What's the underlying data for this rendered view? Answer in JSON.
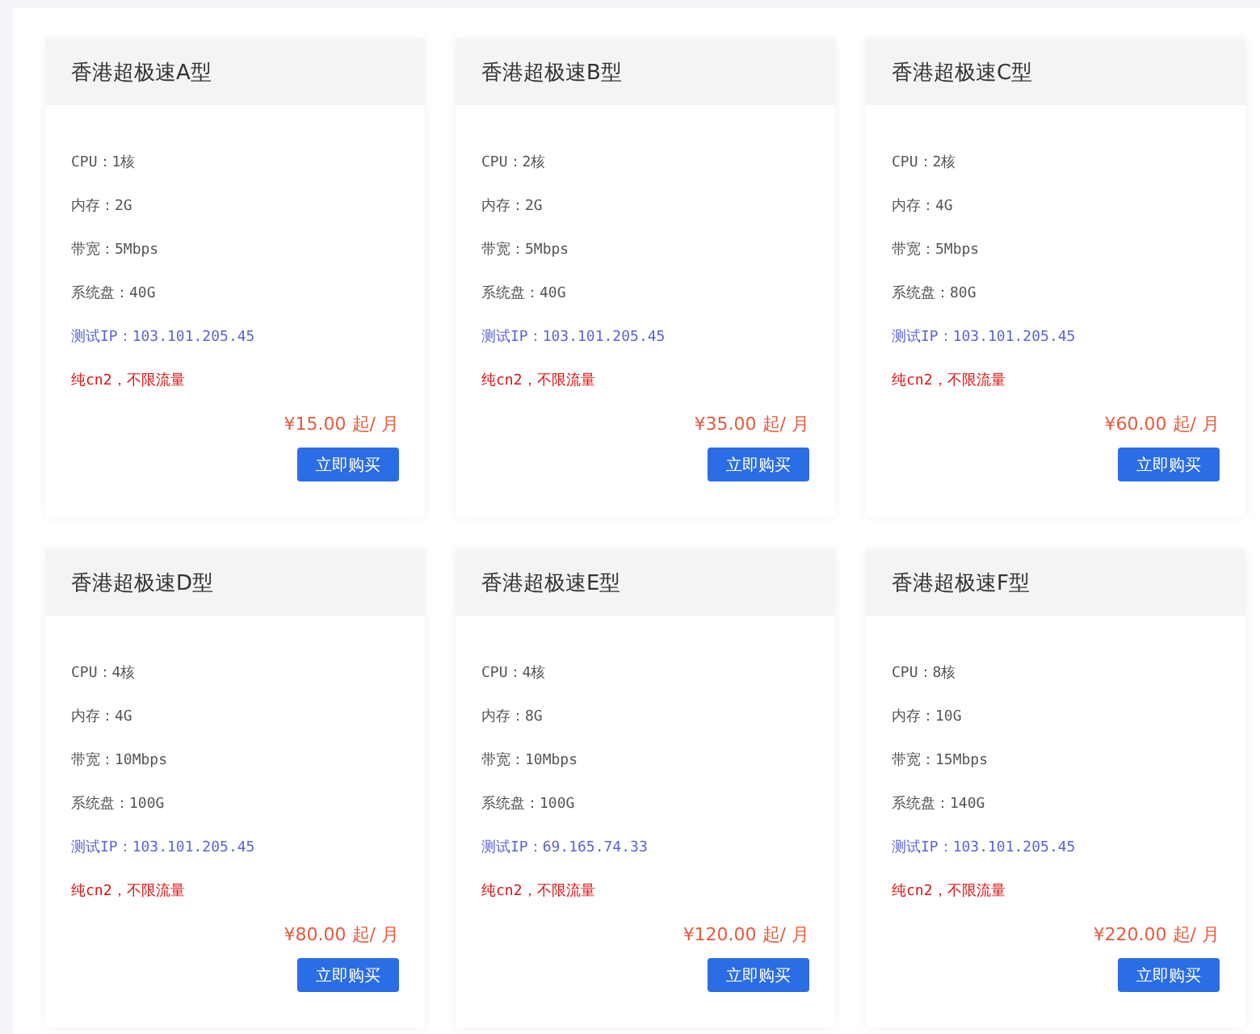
{
  "plans": [
    {
      "title": "香港超极速A型",
      "lines": [
        {
          "kind": "spec",
          "text": "CPU：1核"
        },
        {
          "kind": "spec",
          "text": "内存：2G"
        },
        {
          "kind": "spec",
          "text": "带宽：5Mbps"
        },
        {
          "kind": "spec",
          "text": "系统盘：40G"
        },
        {
          "kind": "ip",
          "text": "测试IP：103.101.205.45"
        },
        {
          "kind": "note",
          "text": "纯cn2，不限流量"
        }
      ],
      "price": "¥15.00 起/ 月",
      "button": "立即购买"
    },
    {
      "title": "香港超极速B型",
      "lines": [
        {
          "kind": "spec",
          "text": "CPU：2核"
        },
        {
          "kind": "spec",
          "text": "内存：2G"
        },
        {
          "kind": "spec",
          "text": "带宽：5Mbps"
        },
        {
          "kind": "spec",
          "text": "系统盘：40G"
        },
        {
          "kind": "ip",
          "text": "测试IP：103.101.205.45"
        },
        {
          "kind": "note",
          "text": "纯cn2，不限流量"
        }
      ],
      "price": "¥35.00 起/ 月",
      "button": "立即购买"
    },
    {
      "title": "香港超极速C型",
      "lines": [
        {
          "kind": "spec",
          "text": "CPU：2核"
        },
        {
          "kind": "spec",
          "text": "内存：4G"
        },
        {
          "kind": "spec",
          "text": "带宽：5Mbps"
        },
        {
          "kind": "spec",
          "text": "系统盘：80G"
        },
        {
          "kind": "ip",
          "text": "测试IP：103.101.205.45"
        },
        {
          "kind": "note",
          "text": "纯cn2，不限流量"
        }
      ],
      "price": "¥60.00 起/ 月",
      "button": "立即购买"
    },
    {
      "title": "香港超极速D型",
      "lines": [
        {
          "kind": "spec",
          "text": "CPU：4核"
        },
        {
          "kind": "spec",
          "text": "内存：4G"
        },
        {
          "kind": "spec",
          "text": "带宽：10Mbps"
        },
        {
          "kind": "spec",
          "text": "系统盘：100G"
        },
        {
          "kind": "ip",
          "text": "测试IP：103.101.205.45"
        },
        {
          "kind": "note",
          "text": "纯cn2，不限流量"
        }
      ],
      "price": "¥80.00 起/ 月",
      "button": "立即购买"
    },
    {
      "title": "香港超极速E型",
      "lines": [
        {
          "kind": "spec",
          "text": "CPU：4核"
        },
        {
          "kind": "spec",
          "text": "内存：8G"
        },
        {
          "kind": "spec",
          "text": "带宽：10Mbps"
        },
        {
          "kind": "spec",
          "text": "系统盘：100G"
        },
        {
          "kind": "ip",
          "text": "测试IP：69.165.74.33"
        },
        {
          "kind": "note",
          "text": "纯cn2，不限流量"
        }
      ],
      "price": "¥120.00 起/ 月",
      "button": "立即购买"
    },
    {
      "title": "香港超极速F型",
      "lines": [
        {
          "kind": "spec",
          "text": "CPU：8核"
        },
        {
          "kind": "spec",
          "text": "内存：10G"
        },
        {
          "kind": "spec",
          "text": "带宽：15Mbps"
        },
        {
          "kind": "spec",
          "text": "系统盘：140G"
        },
        {
          "kind": "ip",
          "text": "测试IP：103.101.205.45"
        },
        {
          "kind": "note",
          "text": "纯cn2，不限流量"
        }
      ],
      "price": "¥220.00 起/ 月",
      "button": "立即购买"
    }
  ]
}
